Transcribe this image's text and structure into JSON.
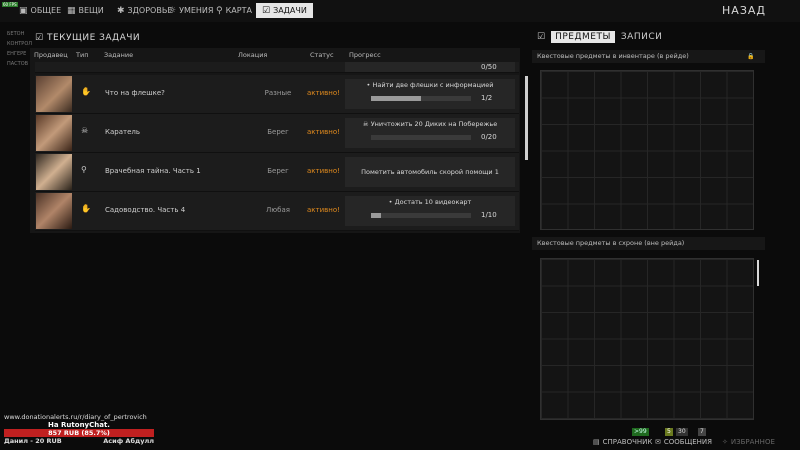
{
  "topnav": {
    "fps": "60 FPS",
    "tabs": [
      {
        "label": "ОБЩЕЕ",
        "icon": "person-icon"
      },
      {
        "label": "ВЕЩИ",
        "icon": "stash-icon"
      },
      {
        "label": "ЗДОРОВЬЕ",
        "icon": "health-icon"
      },
      {
        "label": "УМЕНИЯ",
        "icon": "bulb-icon"
      },
      {
        "label": "КАРТА",
        "icon": "map-pin-icon"
      },
      {
        "label": "ЗАДАЧИ",
        "icon": "tasks-icon",
        "active": true
      }
    ],
    "back": "НАЗАД"
  },
  "traders": [
    "БЕТОН",
    "КОНТРОЛ",
    "ЕНГЕРЕ",
    "ПАСТОВ"
  ],
  "tasks": {
    "title": "ТЕКУЩИЕ ЗАДАЧИ",
    "columns": [
      "Продавец",
      "Тип",
      "Задание",
      "Локация",
      "Статус",
      "Прогресс"
    ],
    "partial_count": "0/50",
    "rows": [
      {
        "type_icon": "hand-icon",
        "name": "Что на флешке?",
        "location": "Разные",
        "status": "активно!",
        "objective": "Найти две флешки с информацией",
        "progress": 0.5,
        "count": "1/2",
        "bullet": "•",
        "portrait": "linear-gradient(135deg,#3d2a1e,#a07050 50%,#2b1d14)"
      },
      {
        "type_icon": "skull-icon",
        "name": "Каратель",
        "location": "Берег",
        "status": "активно!",
        "objective": "Уничтожить 20 Диких на Побережье",
        "progress": 0,
        "count": "0/20",
        "bullet": "☠",
        "portrait": "linear-gradient(135deg,#5a3a28,#c29a7a 50%,#3a2418)"
      },
      {
        "type_icon": "pin-icon",
        "name": "Врачебная тайна. Часть 1",
        "location": "Берег",
        "status": "активно!",
        "objective": "Пометить автомобиль скорой помощи 1",
        "progress": null,
        "count": "",
        "bullet": "",
        "portrait": "linear-gradient(135deg,#302820,#d0b090 50%,#2a221a)"
      },
      {
        "type_icon": "hand-icon",
        "name": "Садоводство. Часть 4",
        "location": "Любая",
        "status": "активно!",
        "objective": "Достать 10 видеокарт",
        "progress": 0.1,
        "count": "1/10",
        "bullet": "•",
        "portrait": "linear-gradient(135deg,#4a3226,#b08468 50%,#2a1a12)"
      }
    ]
  },
  "right": {
    "tab_items": "ПРЕДМЕТЫ",
    "tab_notes": "ЗАПИСИ",
    "inventory_label": "Квестовые предметы в инвентаре (в рейде)",
    "stash_label": "Квестовые предметы в схроне (вне рейда)"
  },
  "donation": {
    "url": "www.donationalerts.ru/r/diary_of_pertrovich",
    "title": "На RutonyChat.",
    "amount": "857 RUB (85.7%)",
    "progress": 0.857,
    "donor1": "Данил - 20 RUB",
    "donor2": "Асиф Абдулл"
  },
  "bottom": {
    "guide": "СПРАВОЧНИК",
    "messages": "СООБЩЕНИЯ",
    "favorites": "ИЗБРАННОЕ",
    "badge1": ">99",
    "badge2": "5",
    "badge3": "30",
    "badge4": "7"
  },
  "colors": {
    "status": "#e08a1e",
    "accent": "#e6e6e6",
    "donation": "#c02020"
  }
}
